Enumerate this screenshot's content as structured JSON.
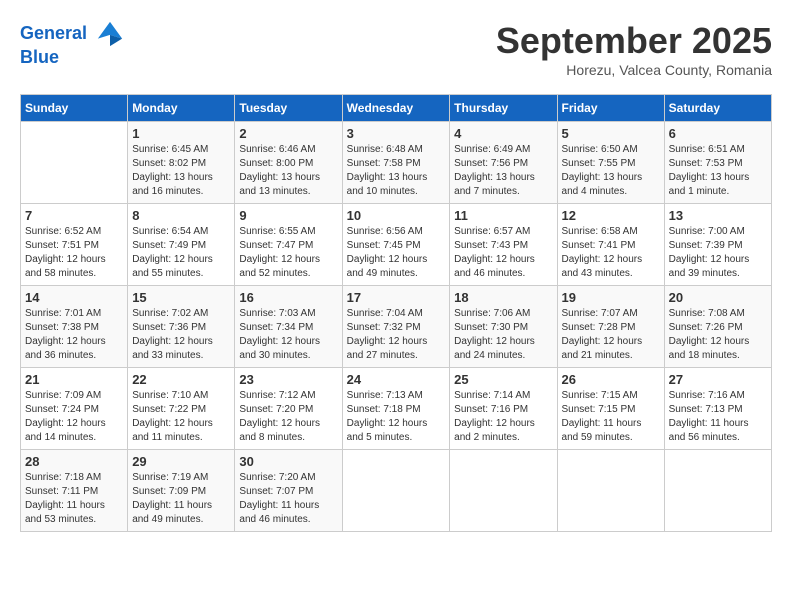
{
  "header": {
    "logo_line1": "General",
    "logo_line2": "Blue",
    "month": "September 2025",
    "location": "Horezu, Valcea County, Romania"
  },
  "weekdays": [
    "Sunday",
    "Monday",
    "Tuesday",
    "Wednesday",
    "Thursday",
    "Friday",
    "Saturday"
  ],
  "weeks": [
    [
      {
        "day": "",
        "sunrise": "",
        "sunset": "",
        "daylight": ""
      },
      {
        "day": "1",
        "sunrise": "Sunrise: 6:45 AM",
        "sunset": "Sunset: 8:02 PM",
        "daylight": "Daylight: 13 hours and 16 minutes."
      },
      {
        "day": "2",
        "sunrise": "Sunrise: 6:46 AM",
        "sunset": "Sunset: 8:00 PM",
        "daylight": "Daylight: 13 hours and 13 minutes."
      },
      {
        "day": "3",
        "sunrise": "Sunrise: 6:48 AM",
        "sunset": "Sunset: 7:58 PM",
        "daylight": "Daylight: 13 hours and 10 minutes."
      },
      {
        "day": "4",
        "sunrise": "Sunrise: 6:49 AM",
        "sunset": "Sunset: 7:56 PM",
        "daylight": "Daylight: 13 hours and 7 minutes."
      },
      {
        "day": "5",
        "sunrise": "Sunrise: 6:50 AM",
        "sunset": "Sunset: 7:55 PM",
        "daylight": "Daylight: 13 hours and 4 minutes."
      },
      {
        "day": "6",
        "sunrise": "Sunrise: 6:51 AM",
        "sunset": "Sunset: 7:53 PM",
        "daylight": "Daylight: 13 hours and 1 minute."
      }
    ],
    [
      {
        "day": "7",
        "sunrise": "Sunrise: 6:52 AM",
        "sunset": "Sunset: 7:51 PM",
        "daylight": "Daylight: 12 hours and 58 minutes."
      },
      {
        "day": "8",
        "sunrise": "Sunrise: 6:54 AM",
        "sunset": "Sunset: 7:49 PM",
        "daylight": "Daylight: 12 hours and 55 minutes."
      },
      {
        "day": "9",
        "sunrise": "Sunrise: 6:55 AM",
        "sunset": "Sunset: 7:47 PM",
        "daylight": "Daylight: 12 hours and 52 minutes."
      },
      {
        "day": "10",
        "sunrise": "Sunrise: 6:56 AM",
        "sunset": "Sunset: 7:45 PM",
        "daylight": "Daylight: 12 hours and 49 minutes."
      },
      {
        "day": "11",
        "sunrise": "Sunrise: 6:57 AM",
        "sunset": "Sunset: 7:43 PM",
        "daylight": "Daylight: 12 hours and 46 minutes."
      },
      {
        "day": "12",
        "sunrise": "Sunrise: 6:58 AM",
        "sunset": "Sunset: 7:41 PM",
        "daylight": "Daylight: 12 hours and 43 minutes."
      },
      {
        "day": "13",
        "sunrise": "Sunrise: 7:00 AM",
        "sunset": "Sunset: 7:39 PM",
        "daylight": "Daylight: 12 hours and 39 minutes."
      }
    ],
    [
      {
        "day": "14",
        "sunrise": "Sunrise: 7:01 AM",
        "sunset": "Sunset: 7:38 PM",
        "daylight": "Daylight: 12 hours and 36 minutes."
      },
      {
        "day": "15",
        "sunrise": "Sunrise: 7:02 AM",
        "sunset": "Sunset: 7:36 PM",
        "daylight": "Daylight: 12 hours and 33 minutes."
      },
      {
        "day": "16",
        "sunrise": "Sunrise: 7:03 AM",
        "sunset": "Sunset: 7:34 PM",
        "daylight": "Daylight: 12 hours and 30 minutes."
      },
      {
        "day": "17",
        "sunrise": "Sunrise: 7:04 AM",
        "sunset": "Sunset: 7:32 PM",
        "daylight": "Daylight: 12 hours and 27 minutes."
      },
      {
        "day": "18",
        "sunrise": "Sunrise: 7:06 AM",
        "sunset": "Sunset: 7:30 PM",
        "daylight": "Daylight: 12 hours and 24 minutes."
      },
      {
        "day": "19",
        "sunrise": "Sunrise: 7:07 AM",
        "sunset": "Sunset: 7:28 PM",
        "daylight": "Daylight: 12 hours and 21 minutes."
      },
      {
        "day": "20",
        "sunrise": "Sunrise: 7:08 AM",
        "sunset": "Sunset: 7:26 PM",
        "daylight": "Daylight: 12 hours and 18 minutes."
      }
    ],
    [
      {
        "day": "21",
        "sunrise": "Sunrise: 7:09 AM",
        "sunset": "Sunset: 7:24 PM",
        "daylight": "Daylight: 12 hours and 14 minutes."
      },
      {
        "day": "22",
        "sunrise": "Sunrise: 7:10 AM",
        "sunset": "Sunset: 7:22 PM",
        "daylight": "Daylight: 12 hours and 11 minutes."
      },
      {
        "day": "23",
        "sunrise": "Sunrise: 7:12 AM",
        "sunset": "Sunset: 7:20 PM",
        "daylight": "Daylight: 12 hours and 8 minutes."
      },
      {
        "day": "24",
        "sunrise": "Sunrise: 7:13 AM",
        "sunset": "Sunset: 7:18 PM",
        "daylight": "Daylight: 12 hours and 5 minutes."
      },
      {
        "day": "25",
        "sunrise": "Sunrise: 7:14 AM",
        "sunset": "Sunset: 7:16 PM",
        "daylight": "Daylight: 12 hours and 2 minutes."
      },
      {
        "day": "26",
        "sunrise": "Sunrise: 7:15 AM",
        "sunset": "Sunset: 7:15 PM",
        "daylight": "Daylight: 11 hours and 59 minutes."
      },
      {
        "day": "27",
        "sunrise": "Sunrise: 7:16 AM",
        "sunset": "Sunset: 7:13 PM",
        "daylight": "Daylight: 11 hours and 56 minutes."
      }
    ],
    [
      {
        "day": "28",
        "sunrise": "Sunrise: 7:18 AM",
        "sunset": "Sunset: 7:11 PM",
        "daylight": "Daylight: 11 hours and 53 minutes."
      },
      {
        "day": "29",
        "sunrise": "Sunrise: 7:19 AM",
        "sunset": "Sunset: 7:09 PM",
        "daylight": "Daylight: 11 hours and 49 minutes."
      },
      {
        "day": "30",
        "sunrise": "Sunrise: 7:20 AM",
        "sunset": "Sunset: 7:07 PM",
        "daylight": "Daylight: 11 hours and 46 minutes."
      },
      {
        "day": "",
        "sunrise": "",
        "sunset": "",
        "daylight": ""
      },
      {
        "day": "",
        "sunrise": "",
        "sunset": "",
        "daylight": ""
      },
      {
        "day": "",
        "sunrise": "",
        "sunset": "",
        "daylight": ""
      },
      {
        "day": "",
        "sunrise": "",
        "sunset": "",
        "daylight": ""
      }
    ]
  ]
}
